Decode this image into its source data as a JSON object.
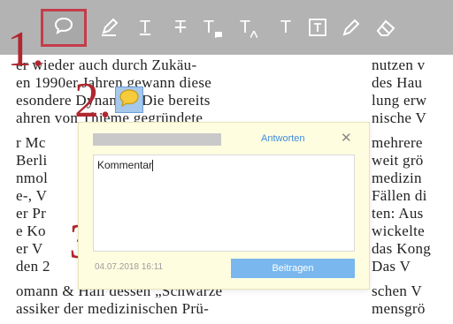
{
  "toolbar": {
    "tools": [
      {
        "name": "comment-icon"
      },
      {
        "name": "highlight-pen-icon"
      },
      {
        "name": "text-underline-icon",
        "glyph": "T"
      },
      {
        "name": "text-strikethrough-icon",
        "glyph": "T"
      },
      {
        "name": "text-replace-icon",
        "glyph": "T"
      },
      {
        "name": "text-insert-icon",
        "glyph": "T"
      },
      {
        "name": "text-tool-icon",
        "glyph": "T"
      },
      {
        "name": "textbox-icon",
        "glyph": "T"
      },
      {
        "name": "pencil-icon"
      },
      {
        "name": "eraser-icon"
      }
    ],
    "colors": {
      "bar": "#b3b3b3",
      "selected_border": "#c43c4a"
    }
  },
  "markers": {
    "one": "1.",
    "two": "2.",
    "three": "3."
  },
  "document": {
    "left_lines": [
      "er wieder auch durch Zukäu-",
      "en 1990er Jahren gewann diese",
      "esondere Dynamik: Die bereits",
      "ahren von Thieme gegründete",
      "r Mc",
      "Berli",
      "nmol",
      "e-, V",
      "er Pr",
      "e Ko",
      "er V",
      "den 2",
      "omann & Hall dessen „Schwarze",
      "assiker der medizinischen Prü-"
    ],
    "right_lines": [
      "nutzen v",
      "des Hau",
      "lung erw",
      "nische V",
      "mehrere",
      "weit grö",
      "medizin",
      "Fällen di",
      "ten: Aus",
      "wickelte",
      "das Kong",
      "   Das V",
      "schen V",
      "mensgrö"
    ]
  },
  "popup": {
    "reply_label": "Antworten",
    "close_glyph": "✕",
    "comment_value": "Kommentar",
    "date": "04.07.2018 16:11",
    "submit_label": "Beitragen",
    "colors": {
      "background": "#fffde0",
      "accent": "#3f8cdc",
      "button": "#79b7ee"
    }
  },
  "note_icon": {
    "name": "comment-note-icon",
    "color": "#a5c8ec"
  }
}
